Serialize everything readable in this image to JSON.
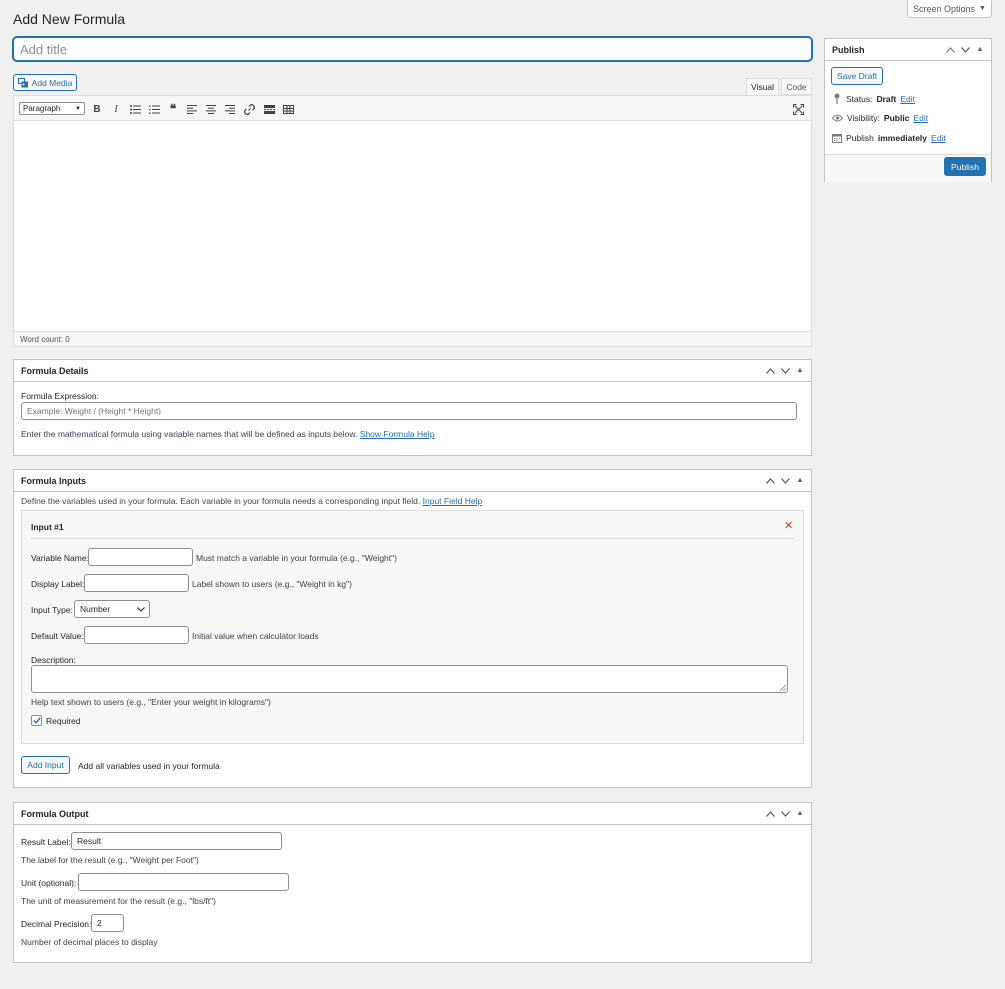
{
  "header": {
    "title": "Add New Formula",
    "screen_options_label": "Screen Options"
  },
  "title_field": {
    "placeholder": "Add title",
    "value": ""
  },
  "editor": {
    "add_media_label": "Add Media",
    "tabs": {
      "visual": "Visual",
      "code": "Code"
    },
    "format_select": "Paragraph",
    "word_count": "Word count: 0"
  },
  "publish": {
    "heading": "Publish",
    "save_draft": "Save Draft",
    "status_label": "Status:",
    "status_value": "Draft",
    "visibility_label": "Visibility:",
    "visibility_value": "Public",
    "schedule_label": "Publish",
    "schedule_value": "immediately",
    "edit_link": "Edit",
    "publish_button": "Publish"
  },
  "formula_details": {
    "heading": "Formula Details",
    "expression_label": "Formula Expression:",
    "expression_placeholder": "Example: Weight / (Height * Height)",
    "help_text": "Enter the mathematical formula using variable names that will be defined as inputs below.",
    "help_link": "Show Formula Help"
  },
  "formula_inputs": {
    "heading": "Formula Inputs",
    "intro": "Define the variables used in your formula. Each variable in your formula needs a corresponding input field.",
    "help_link": "Input Field Help",
    "item": {
      "title": "Input #1",
      "variable_name_label": "Variable Name:",
      "variable_name_value": "",
      "variable_name_hint": "Must match a variable in your formula (e.g., \"Weight\")",
      "display_label_label": "Display Label:",
      "display_label_value": "",
      "display_label_hint": "Label shown to users (e.g., \"Weight in kg\")",
      "input_type_label": "Input Type:",
      "input_type_value": "Number",
      "default_value_label": "Default Value:",
      "default_value_value": "",
      "default_value_hint": "Initial value when calculator loads",
      "description_label": "Description:",
      "description_hint": "Help text shown to users (e.g., \"Enter your weight in kilograms\")",
      "required_label": "Required",
      "required_checked": true
    },
    "add_input_button": "Add Input",
    "add_input_hint": "Add all variables used in your formula"
  },
  "formula_output": {
    "heading": "Formula Output",
    "result_label_label": "Result Label:",
    "result_label_value": "Result",
    "result_label_hint": "The label for the result (e.g., \"Weight per Foot\")",
    "unit_label": "Unit (optional):",
    "unit_value": "",
    "unit_hint": "The unit of measurement for the result (e.g., \"lbs/ft\")",
    "precision_label": "Decimal Precision:",
    "precision_value": "2",
    "precision_hint": "Number of decimal places to display"
  },
  "colors": {
    "accent": "#2271b1",
    "remove": "#d63638",
    "background": "#f0f0f1"
  }
}
